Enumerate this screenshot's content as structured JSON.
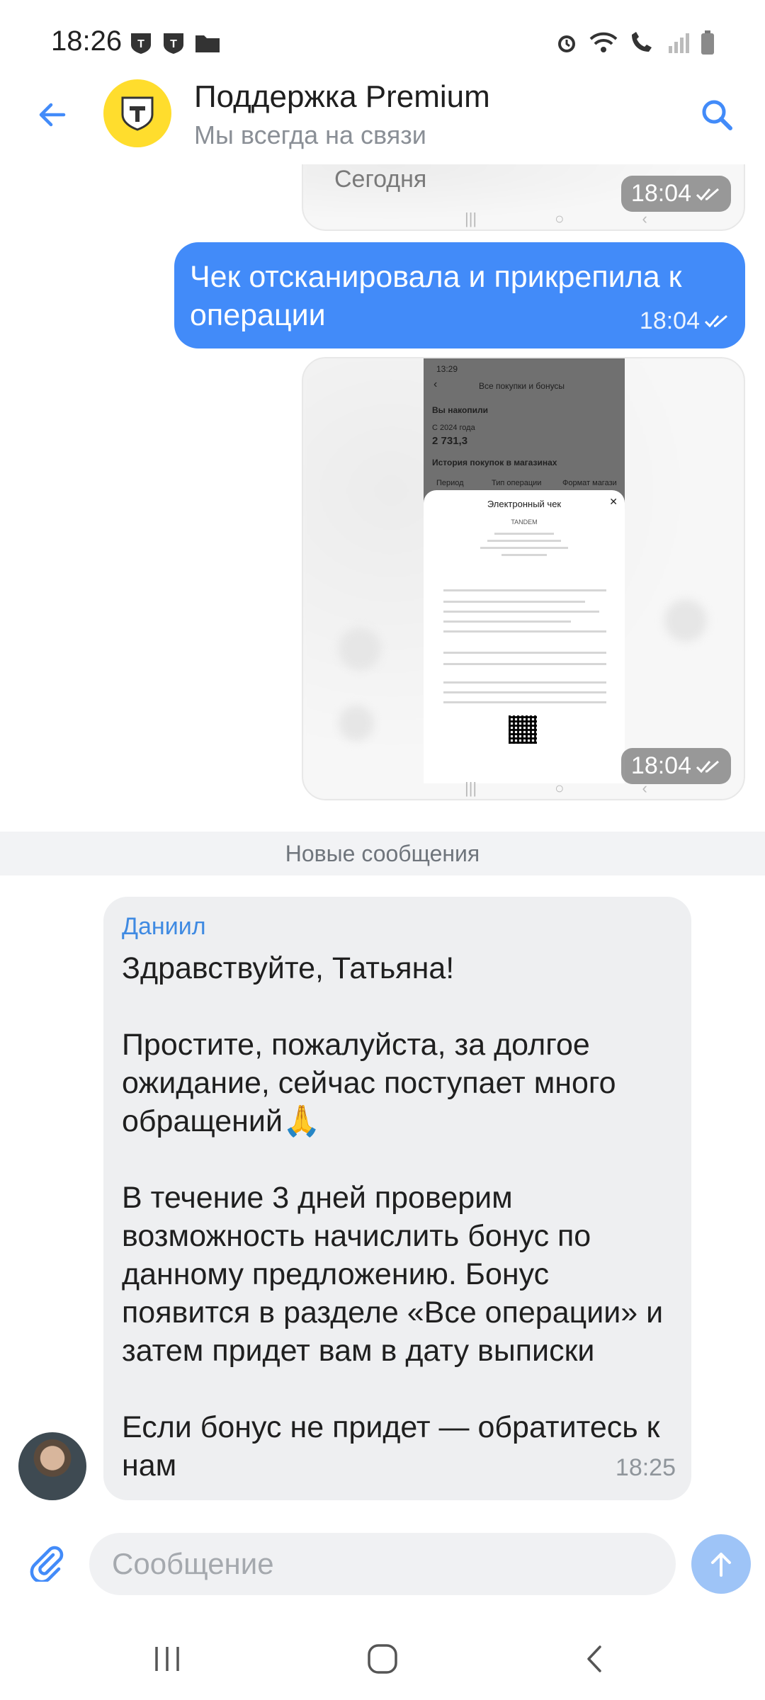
{
  "status_bar": {
    "time": "18:26"
  },
  "header": {
    "title": "Поддержка Premium",
    "subtitle": "Мы всегда на связи",
    "accent_color": "#428bf9",
    "avatar_color": "#ffdd2d"
  },
  "messages": {
    "img1": {
      "day_label": "Сегодня",
      "time": "18:04"
    },
    "out_text": {
      "text": "Чек отсканировала и прикрепила к операции",
      "time": "18:04"
    },
    "img2": {
      "time": "18:04",
      "screenshot": {
        "time": "13:29",
        "title": "Все покупки и бонусы",
        "accumulated_label": "Вы накопили",
        "since_label": "С 2024 года",
        "accumulated_value": "2 731,3",
        "history_label": "История покупок в магазинах",
        "filter_period": "Период",
        "filter_type": "Тип операции",
        "filter_format": "Формат магази",
        "receipt_title": "Электронный чек",
        "receipt_store": "TANDEM"
      }
    },
    "new_messages_divider": "Новые сообщения",
    "incoming": {
      "sender": "Даниил",
      "text": "Здравствуйте, Татьяна!\n\nПростите, пожалуйста, за долгое ожидание, сейчас поступает много обращений🙏\n\nВ течение 3 дней проверим возможность начислить бонус по данному предложению. Бонус появится в разделе «Все операции» и затем придет вам в дату выписки\n\nЕсли бонус не придет — обратитесь к нам",
      "time": "18:25"
    }
  },
  "composer": {
    "placeholder": "Сообщение"
  }
}
